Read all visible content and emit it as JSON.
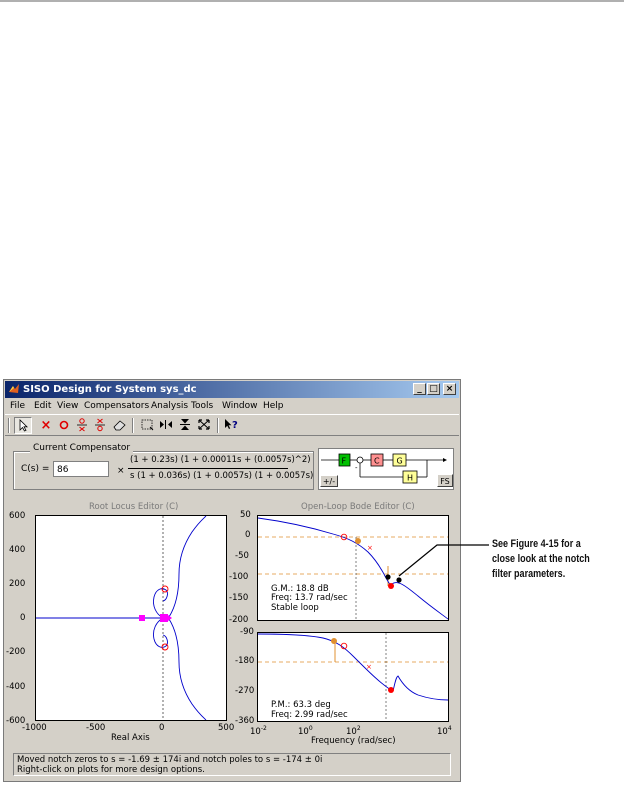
{
  "window": {
    "title": "SISO Design for System sys_dc",
    "controls": {
      "minimize": "_",
      "maximize": "□",
      "close": "×"
    }
  },
  "menu": [
    "File",
    "Edit",
    "View",
    "Compensators",
    "Analysis",
    "Tools",
    "Window",
    "Help"
  ],
  "toolbar_icons": [
    "select-arrow-icon",
    "add-pole-icon",
    "add-zero-icon",
    "add-lead-icon",
    "add-lag-icon",
    "erase-icon",
    "zoom-xy-icon",
    "zoom-x-icon",
    "zoom-y-icon",
    "full-view-icon",
    "whats-this-icon"
  ],
  "compensator": {
    "legend": "Current Compensator",
    "label": "C(s) =",
    "gain": "86",
    "times": "×",
    "numerator": "(1 + 0.23s) (1 + 0.00011s + (0.0057s)^2)",
    "denominator": "s (1 + 0.036s) (1 + 0.0057s) (1 + 0.0057s)"
  },
  "loop_diagram": {
    "blocks": {
      "F": "F",
      "C": "C",
      "G": "G",
      "H": "H"
    },
    "block_colors": {
      "F": "#00c000",
      "C": "#ff9090",
      "G": "#ffff99",
      "H": "#ffff99"
    },
    "minus": "-",
    "plus_minus_button": "+/-",
    "fs_button": "FS"
  },
  "root_locus": {
    "title": "Root Locus Editor (C)",
    "xlabel": "Real Axis",
    "x_ticks": [
      "-1000",
      "-500",
      "0",
      "500"
    ],
    "y_ticks": [
      "600",
      "400",
      "200",
      "0",
      "-200",
      "-400",
      "-600"
    ],
    "xlim": [
      -1000,
      500
    ],
    "ylim": [
      -600,
      600
    ]
  },
  "bode": {
    "title": "Open-Loop Bode Editor (C)",
    "xlabel": "Frequency (rad/sec)",
    "mag_ticks": [
      "50",
      "0",
      "-50",
      "-100",
      "-150",
      "-200"
    ],
    "mag_lim": [
      -200,
      50
    ],
    "phase_ticks": [
      "-90",
      "-180",
      "-270",
      "-360"
    ],
    "phase_lim": [
      -360,
      -90
    ],
    "freq_exponents": [
      "-2",
      "0",
      "2",
      "4"
    ],
    "freq_base": "10",
    "gain_margin": "G.M.: 18.8 dB",
    "gain_margin_freq": "Freq: 13.7 rad/sec",
    "stability": "Stable loop",
    "phase_margin": "P.M.: 63.3 deg",
    "phase_margin_freq": "Freq: 2.99 rad/sec"
  },
  "status": {
    "line1": "Moved notch zeros to s = -1.69 ± 174i and notch poles to s = -174 ± 0i",
    "line2": "Right-click on plots for more design options."
  },
  "callout": {
    "text": "See Figure 4-15 for a close look at the notch filter parameters."
  },
  "colors": {
    "curve": "#0000cc",
    "pole": "#ff0000",
    "zero": "#ff0000",
    "compensator_marker": "#ff00ff",
    "margin_line": "#e09030",
    "titlebar_start": "#0a246a",
    "titlebar_end": "#a6caf0"
  }
}
